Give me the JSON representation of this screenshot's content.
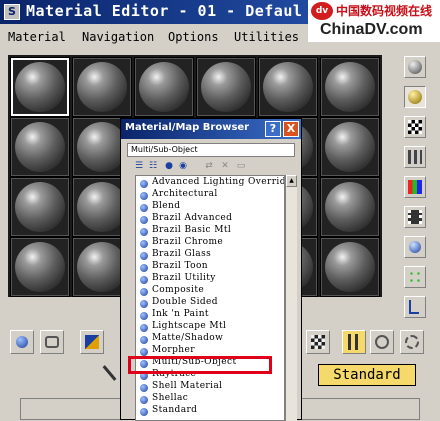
{
  "window": {
    "title": "Material Editor - 01 - Defaul"
  },
  "watermark": {
    "chinese": "中国数码视频在线",
    "site": "ChinaDV.com",
    "logo_text": "dv"
  },
  "menu": [
    {
      "label": "Material"
    },
    {
      "label": "Navigation"
    },
    {
      "label": "Options"
    },
    {
      "label": "Utilities"
    }
  ],
  "browser": {
    "title": "Material/Map Browser",
    "path": "Multi/Sub-Object",
    "help": "?",
    "close": "X",
    "items": [
      "Advanced Lighting Override",
      "Architectural",
      "Blend",
      "Brazil Advanced",
      "Brazil Basic Mtl",
      "Brazil Chrome",
      "Brazil Glass",
      "Brazil Toon",
      "Brazil Utility",
      "Composite",
      "Double Sided",
      "Ink 'n Paint",
      "Lightscape Mtl",
      "Matte/Shadow",
      "Morpher",
      "Multi/Sub-Object",
      "Raytrace",
      "Shell Material",
      "Shellac",
      "Standard"
    ],
    "highlighted_item": "Multi/Sub-Object"
  },
  "material_type": "Standard",
  "colors": {
    "title_bar": "#0a246a",
    "highlight": "#e0001a",
    "type_button": "#f5d96a"
  }
}
